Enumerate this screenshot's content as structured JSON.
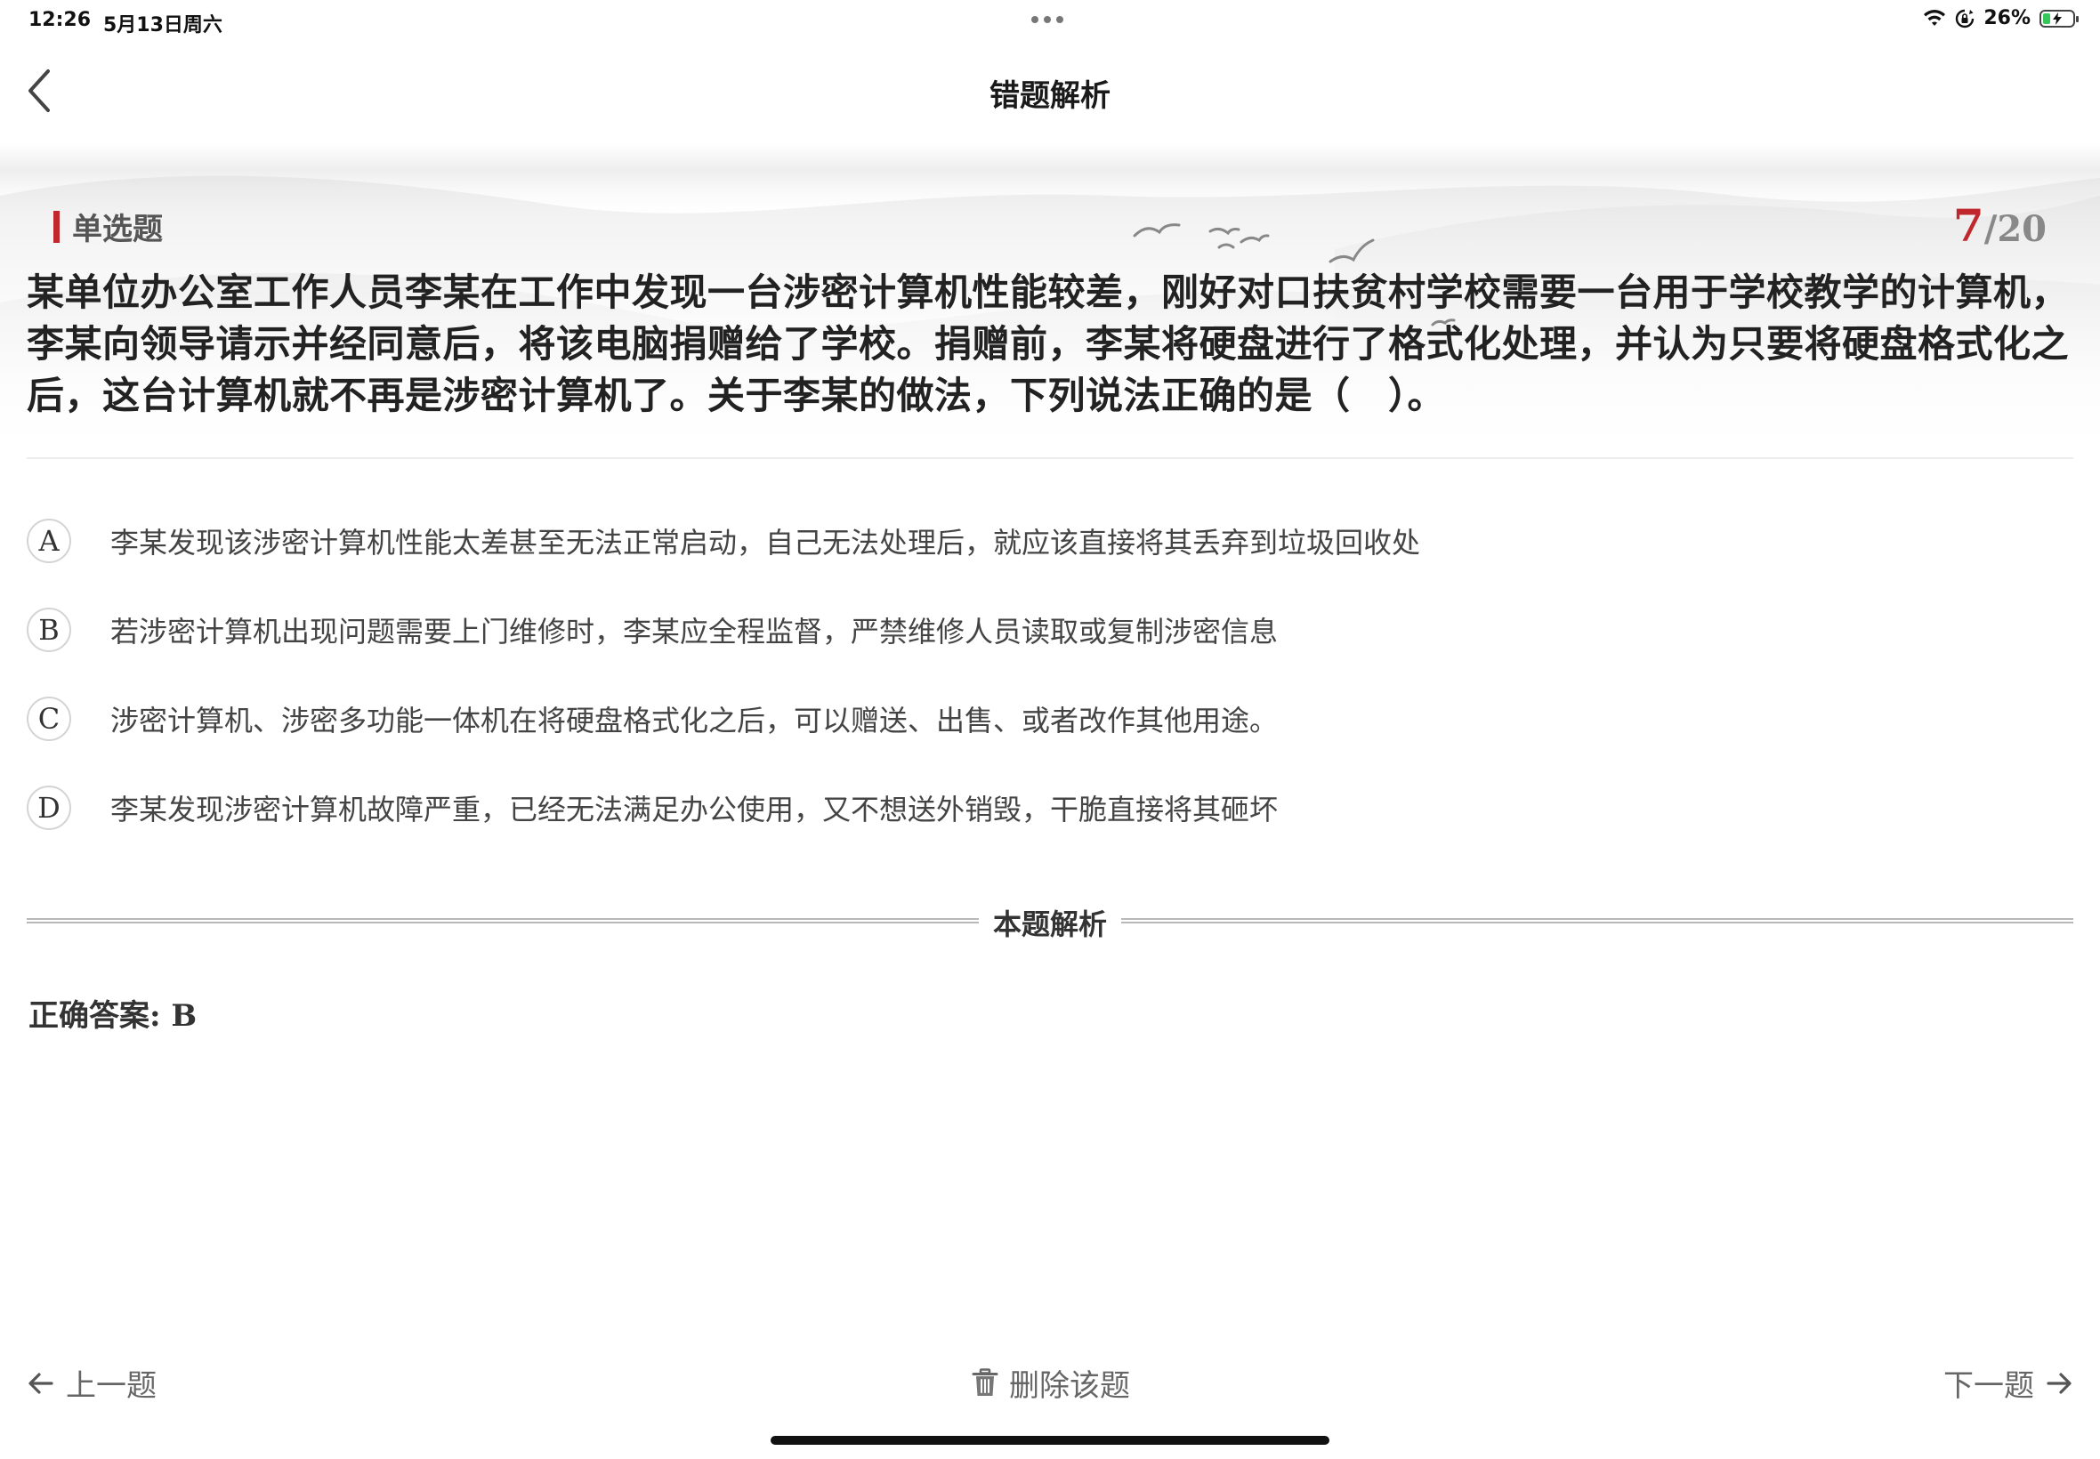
{
  "status_bar": {
    "time": "12:26",
    "date": "5月13日周六",
    "battery_text": "26%",
    "battery_level": 0.26,
    "battery_color": "#34c759",
    "icons": [
      "wifi-icon",
      "orientation-lock-icon",
      "battery-charging-icon"
    ]
  },
  "nav": {
    "title": "错题解析",
    "back_icon": "chevron-left-icon"
  },
  "question": {
    "type_label": "单选题",
    "current": "7",
    "total": "/20",
    "text": "某单位办公室工作人员李某在工作中发现一台涉密计算机性能较差，刚好对口扶贫村学校需要一台用于学校教学的计算机，李某向领导请示并经同意后，将该电脑捐赠给了学校。捐赠前，李某将硬盘进行了格式化处理，并认为只要将硬盘格式化之后，这台计算机就不再是涉密计算机了。关于李某的做法，下列说法正确的是（　）。",
    "accent_color": "#c0282d"
  },
  "options": [
    {
      "letter": "A",
      "text": "李某发现该涉密计算机性能太差甚至无法正常启动，自己无法处理后，就应该直接将其丢弃到垃圾回收处"
    },
    {
      "letter": "B",
      "text": "若涉密计算机出现问题需要上门维修时，李某应全程监督，严禁维修人员读取或复制涉密信息"
    },
    {
      "letter": "C",
      "text": "涉密计算机、涉密多功能一体机在将硬盘格式化之后，可以赠送、出售、或者改作其他用途。"
    },
    {
      "letter": "D",
      "text": "李某发现涉密计算机故障严重，已经无法满足办公使用，又不想送外销毁，干脆直接将其砸坏"
    }
  ],
  "analysis": {
    "title": "本题解析",
    "answer_text": "正确答案: B"
  },
  "bottom_bar": {
    "prev_label": "上一题",
    "delete_label": "删除该题",
    "next_label": "下一题",
    "icons": [
      "arrow-left-icon",
      "trash-icon",
      "arrow-right-icon"
    ]
  }
}
